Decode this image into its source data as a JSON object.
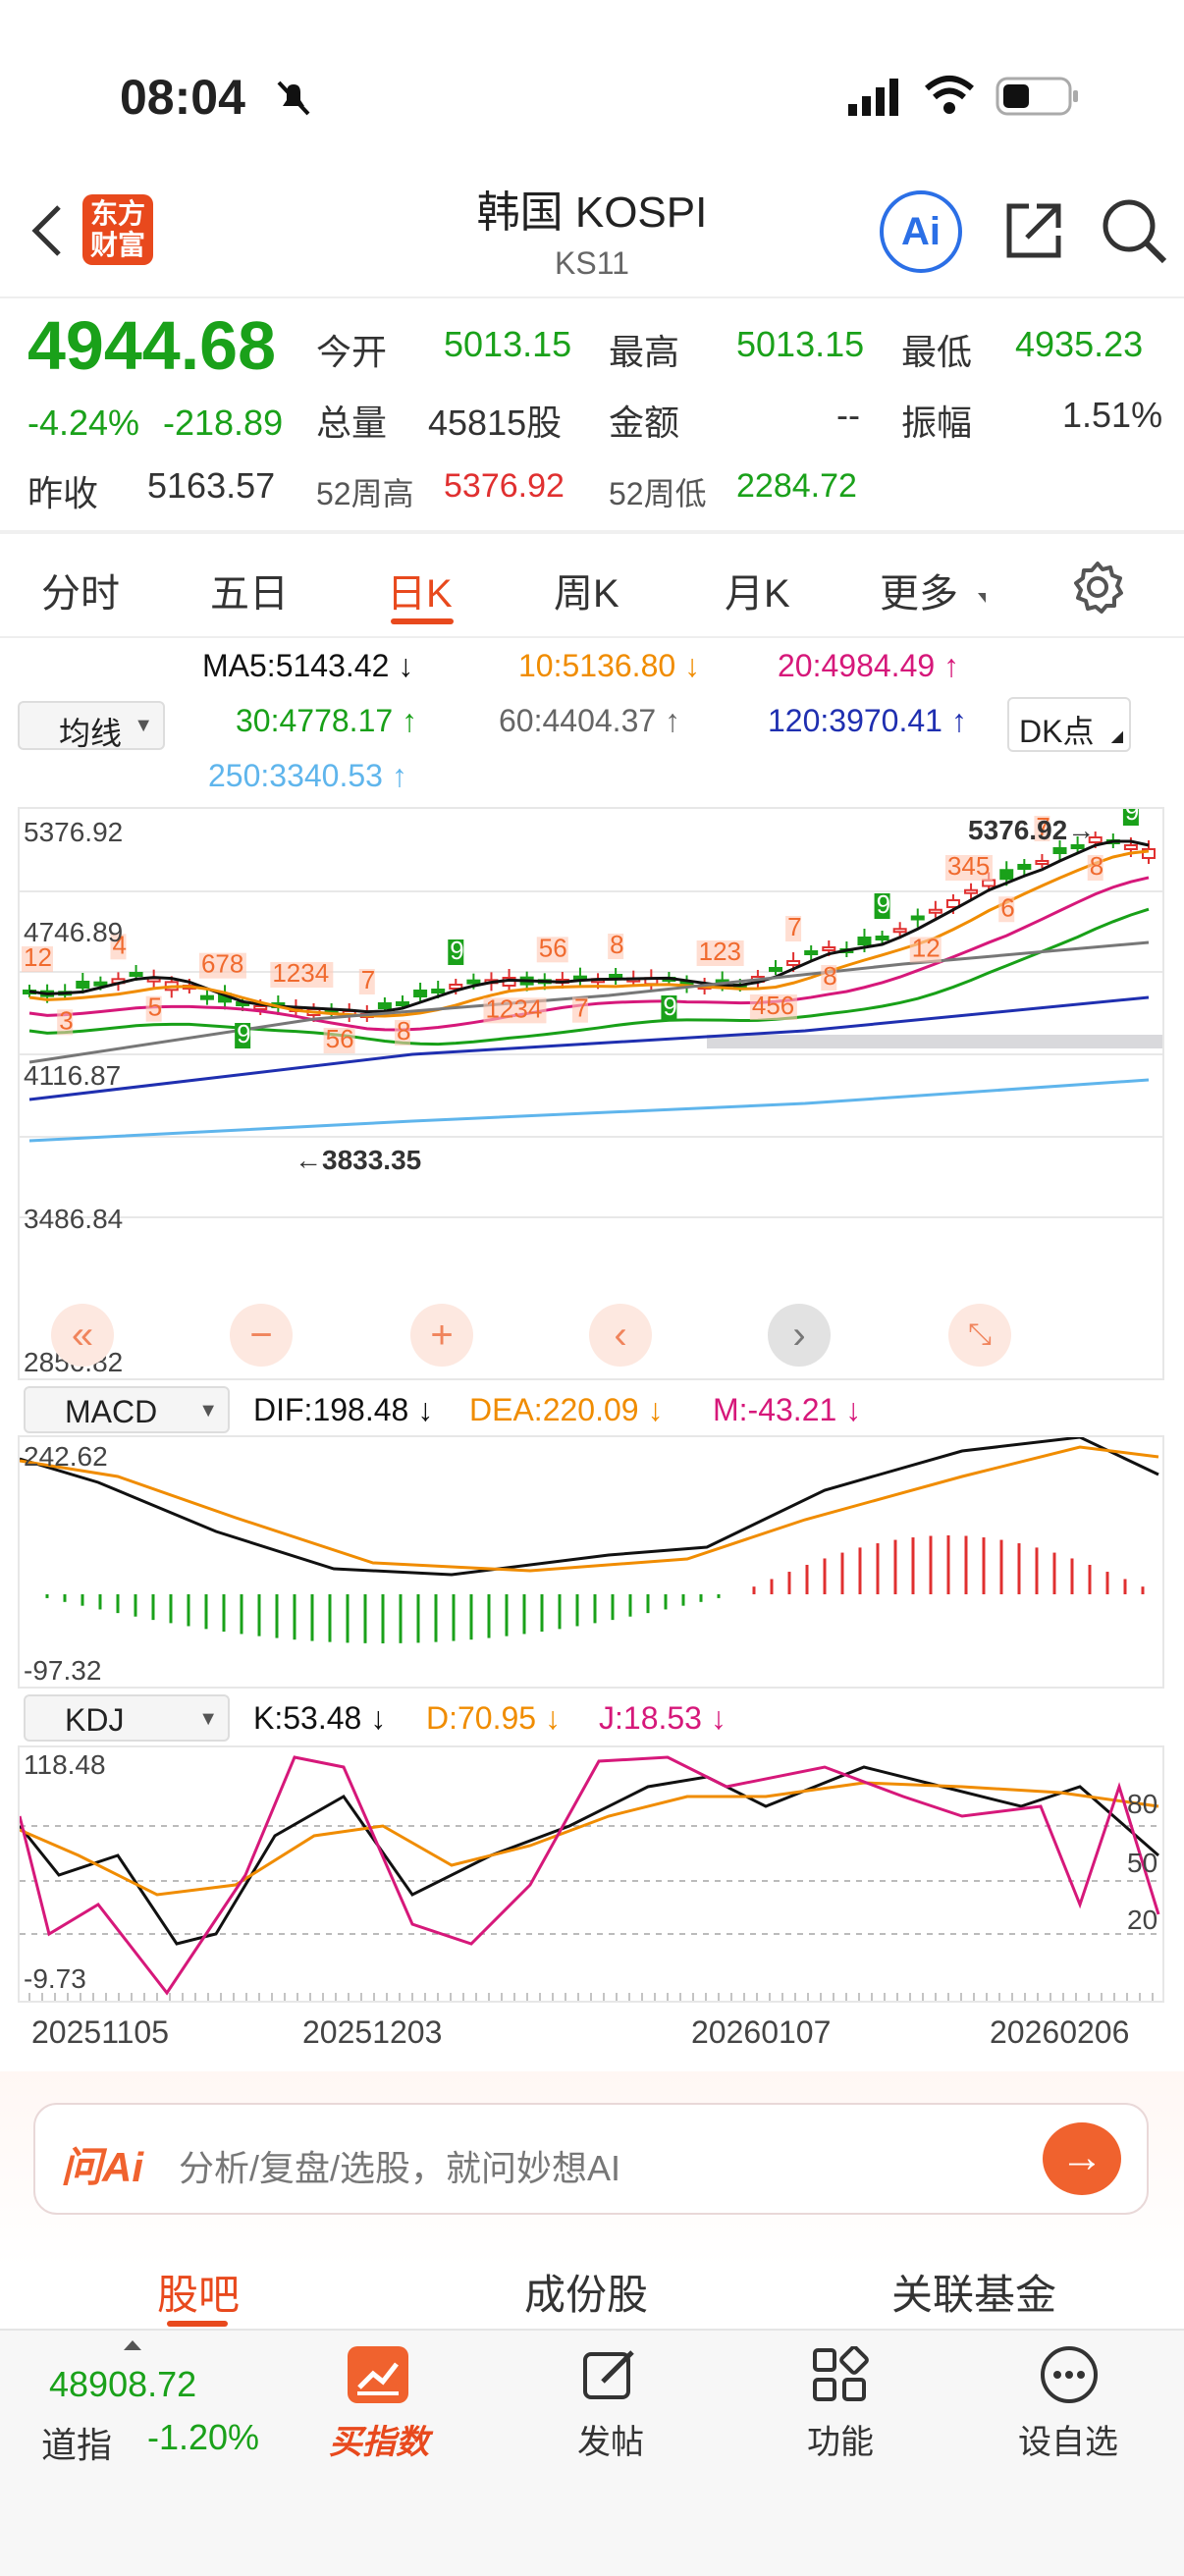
{
  "status": {
    "time": "08:04"
  },
  "header": {
    "brand_line1": "东方",
    "brand_line2": "财富",
    "title": "韩国 KOSPI",
    "code": "KS11",
    "ai_label": "Ai"
  },
  "quote": {
    "price": "4944.68",
    "change_pct": "-4.24%",
    "change_abs": "-218.89",
    "open_label": "今开",
    "open": "5013.15",
    "high_label": "最高",
    "high": "5013.15",
    "low_label": "最低",
    "low": "4935.23",
    "volume_label": "总量",
    "volume": "45815股",
    "amount_label": "金额",
    "amount": "--",
    "amplitude_label": "振幅",
    "amplitude": "1.51%",
    "prev_close_label": "昨收",
    "prev_close": "5163.57",
    "wk52_high_label": "52周高",
    "wk52_high": "5376.92",
    "wk52_low_label": "52周低",
    "wk52_low": "2284.72"
  },
  "tabs": [
    {
      "label": "分时"
    },
    {
      "label": "五日"
    },
    {
      "label": "日K",
      "active": true
    },
    {
      "label": "周K"
    },
    {
      "label": "月K"
    },
    {
      "label": "更多"
    }
  ],
  "ma": {
    "selector": "均线",
    "ma5": "MA5:5143.42 ↓",
    "ma10": "10:5136.80 ↓",
    "ma20": "20:4984.49 ↑",
    "ma30": "30:4778.17 ↑",
    "ma60": "60:4404.37 ↑",
    "ma120": "120:3970.41 ↑",
    "ma250": "250:3340.53 ↑",
    "dk_button": "DK点"
  },
  "colors": {
    "ma5": "#111111",
    "ma10": "#f08c00",
    "ma20": "#d6187a",
    "ma30": "#18a018",
    "ma60": "#777777",
    "ma120": "#1f2fb0",
    "ma250": "#5fb5ec",
    "up": "#e03030",
    "down": "#1aa11a"
  },
  "kline": {
    "y_labels": [
      "5376.92",
      "4746.89",
      "4116.87",
      "3486.84",
      "2856.82"
    ],
    "max_marker": "5376.92",
    "min_marker": "3833.35",
    "seq_labels": [
      "12",
      "3",
      "4",
      "5",
      "678",
      "9",
      "1234",
      "56",
      "7",
      "8",
      "9",
      "1234",
      "56",
      "7",
      "8",
      "9",
      "123",
      "456",
      "7",
      "8",
      "9",
      "12",
      "345",
      "6",
      "7",
      "8",
      "9"
    ]
  },
  "macd": {
    "selector": "MACD",
    "dif": "DIF:198.48 ↓",
    "dea": "DEA:220.09 ↓",
    "m": "M:-43.21 ↓",
    "y_top": "242.62",
    "y_bottom": "-97.32"
  },
  "kdj": {
    "selector": "KDJ",
    "k": "K:53.48 ↓",
    "d": "D:70.95 ↓",
    "j": "J:18.53 ↓",
    "y_top": "118.48",
    "y_bottom": "-9.73",
    "levels": [
      "80",
      "50",
      "20"
    ]
  },
  "dates": [
    "20251105",
    "20251203",
    "20260107",
    "20260206"
  ],
  "ai_bar": {
    "logo": "问Ai",
    "placeholder": "分析/复盘/选股，就问妙想AI"
  },
  "subtabs": [
    {
      "label": "股吧",
      "active": true
    },
    {
      "label": "成份股"
    },
    {
      "label": "关联基金"
    }
  ],
  "bottom": {
    "index_value": "48908.72",
    "index_name": "道指",
    "index_change": "-1.20%",
    "nav": [
      {
        "label": "买指数",
        "icon": "chart-icon"
      },
      {
        "label": "发帖",
        "icon": "edit-icon"
      },
      {
        "label": "功能",
        "icon": "grid-icon"
      },
      {
        "label": "设自选",
        "icon": "more-icon"
      }
    ]
  }
}
